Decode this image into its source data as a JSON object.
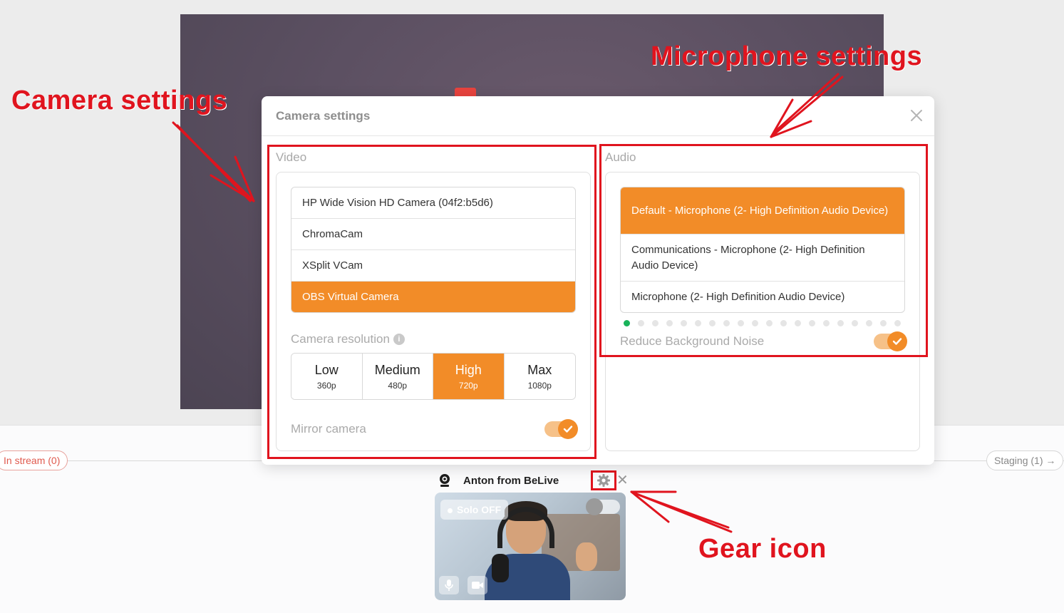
{
  "modal": {
    "title": "Camera settings",
    "video": {
      "section_label": "Video",
      "devices": [
        {
          "label": "HP Wide Vision HD Camera (04f2:b5d6)",
          "selected": false
        },
        {
          "label": "ChromaCam",
          "selected": false
        },
        {
          "label": "XSplit VCam",
          "selected": false
        },
        {
          "label": "OBS Virtual Camera",
          "selected": true
        }
      ],
      "resolution_label": "Camera resolution",
      "resolutions": [
        {
          "name": "Low",
          "value": "360p",
          "selected": false
        },
        {
          "name": "Medium",
          "value": "480p",
          "selected": false
        },
        {
          "name": "High",
          "value": "720p",
          "selected": true
        },
        {
          "name": "Max",
          "value": "1080p",
          "selected": false
        }
      ],
      "mirror_label": "Mirror camera",
      "mirror_on": true
    },
    "audio": {
      "section_label": "Audio",
      "devices": [
        {
          "label": "Default - Microphone (2- High Definition Audio Device)",
          "selected": true
        },
        {
          "label": "Communications - Microphone (2- High Definition Audio Device)",
          "selected": false
        },
        {
          "label": "Microphone (2- High Definition Audio Device)",
          "selected": false
        }
      ],
      "level_meter": {
        "active_dots": 1,
        "total_dots": 20
      },
      "noise_label": "Reduce Background Noise",
      "noise_on": true
    }
  },
  "lanes": {
    "in_stream": "In stream (0)",
    "staging": "Staging (1) →"
  },
  "participant": {
    "name": "Anton from BeLive",
    "solo_label": "Solo OFF"
  },
  "annotations": {
    "camera": "Camera settings",
    "microphone": "Microphone settings",
    "gear": "Gear icon"
  },
  "colors": {
    "accent": "#f28c28",
    "annotation": "#e0141e",
    "meter_active": "#19b35a"
  }
}
